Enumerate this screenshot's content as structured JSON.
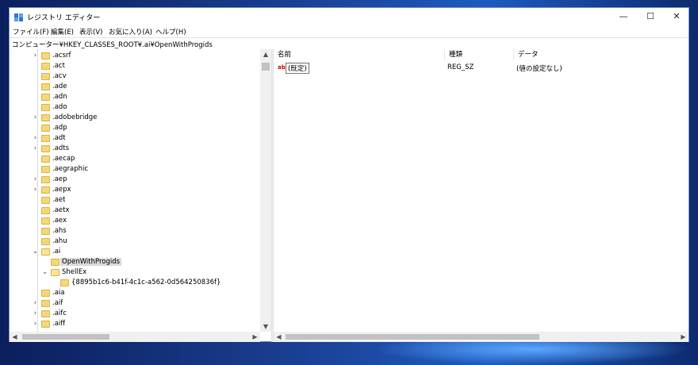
{
  "window": {
    "title": "レジストリ エディター"
  },
  "menu": [
    "ファイル(F)",
    "編集(E)",
    "表示(V)",
    "お気に入り(A)",
    "ヘルプ(H)"
  ],
  "address": "コンピューター¥HKEY_CLASSES_ROOT¥.ai¥OpenWithProgids",
  "tree": [
    {
      "label": ".acsrf",
      "expander": "›",
      "depth": 0
    },
    {
      "label": ".act",
      "expander": "",
      "depth": 0
    },
    {
      "label": ".acv",
      "expander": "",
      "depth": 0
    },
    {
      "label": ".ade",
      "expander": "",
      "depth": 0
    },
    {
      "label": ".adn",
      "expander": "",
      "depth": 0
    },
    {
      "label": ".ado",
      "expander": "",
      "depth": 0
    },
    {
      "label": ".adobebridge",
      "expander": "›",
      "depth": 0
    },
    {
      "label": ".adp",
      "expander": "",
      "depth": 0
    },
    {
      "label": ".adt",
      "expander": "›",
      "depth": 0
    },
    {
      "label": ".adts",
      "expander": "›",
      "depth": 0
    },
    {
      "label": ".aecap",
      "expander": "",
      "depth": 0
    },
    {
      "label": ".aegraphic",
      "expander": "",
      "depth": 0
    },
    {
      "label": ".aep",
      "expander": "›",
      "depth": 0
    },
    {
      "label": ".aepx",
      "expander": "›",
      "depth": 0
    },
    {
      "label": ".aet",
      "expander": "",
      "depth": 0
    },
    {
      "label": ".aetx",
      "expander": "",
      "depth": 0
    },
    {
      "label": ".aex",
      "expander": "",
      "depth": 0
    },
    {
      "label": ".ahs",
      "expander": "",
      "depth": 0
    },
    {
      "label": ".ahu",
      "expander": "",
      "depth": 0
    },
    {
      "label": ".ai",
      "expander": "⌄",
      "depth": 0
    },
    {
      "label": "OpenWithProgids",
      "expander": "",
      "depth": 1,
      "selected": true
    },
    {
      "label": "ShellEx",
      "expander": "⌄",
      "depth": 1
    },
    {
      "label": "{8895b1c6-b41f-4c1c-a562-0d564250836f}",
      "expander": "",
      "depth": 2
    },
    {
      "label": ".aia",
      "expander": "",
      "depth": 0
    },
    {
      "label": ".aif",
      "expander": "›",
      "depth": 0
    },
    {
      "label": ".aifc",
      "expander": "›",
      "depth": 0
    },
    {
      "label": ".aiff",
      "expander": "›",
      "depth": 0
    }
  ],
  "list": {
    "columns": [
      "名前",
      "種類",
      "データ"
    ],
    "rows": [
      {
        "icon": "ab",
        "name": "(既定)",
        "type": "REG_SZ",
        "data": "(値の設定なし)"
      }
    ]
  },
  "controls": {
    "minimize": "—",
    "maximize": "☐",
    "close": "✕"
  },
  "colors": {
    "accent": "#1e5bbf",
    "folder": "#f5d77a"
  }
}
